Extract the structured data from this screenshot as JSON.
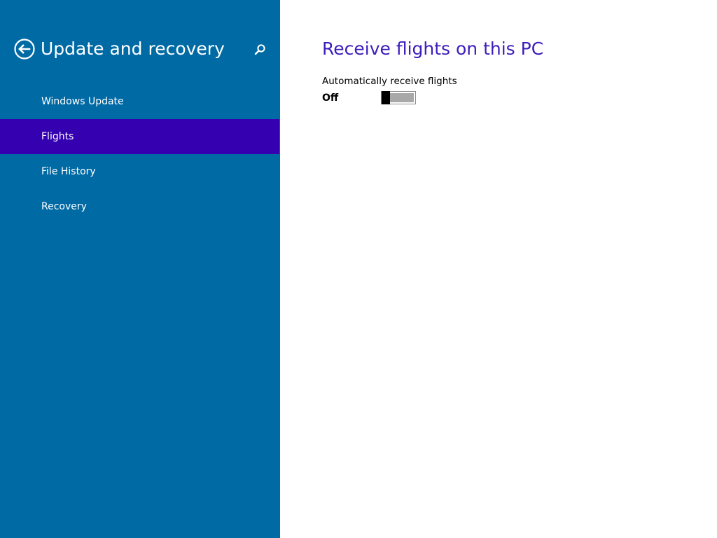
{
  "sidebar": {
    "title": "Update and recovery",
    "back_icon": "back-arrow-circle-icon",
    "search_icon": "search-icon",
    "items": [
      {
        "label": "Windows Update",
        "selected": false
      },
      {
        "label": "Flights",
        "selected": true
      },
      {
        "label": "File History",
        "selected": false
      },
      {
        "label": "Recovery",
        "selected": false
      }
    ]
  },
  "main": {
    "title": "Receive flights on this PC",
    "setting": {
      "label": "Automatically receive flights",
      "state_label": "Off",
      "enabled": false
    }
  },
  "colors": {
    "sidebar_bg": "#006aa5",
    "selected_item_bg": "#3400b0",
    "title_accent": "#3d1dbb",
    "main_bg": "#ffffff"
  }
}
